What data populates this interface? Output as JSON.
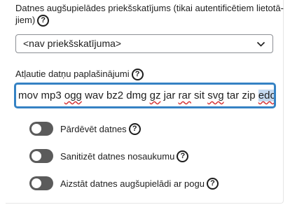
{
  "preview": {
    "label_line1": "Datnes augšupielādes priekšskatījums (tikai autentificētiem lietotā-",
    "label_line2": "jiem)",
    "selected": "<nav priekšskatījuma>"
  },
  "extensions": {
    "label": "Atļautie datņu paplašinājumi",
    "words": [
      "mov",
      "mp3",
      "ogg",
      "wav",
      "bz2",
      "dmg",
      "gz",
      "jar",
      "rar",
      "sit",
      "svg",
      "tar",
      "zip",
      "edoc"
    ]
  },
  "toggles": [
    {
      "label": "Pārdēvēt datnes",
      "on": false
    },
    {
      "label": "Sanitizēt datnes nosaukumu",
      "on": false
    },
    {
      "label": "Aizstāt datnes augšupielādi ar pogu",
      "on": false
    }
  ],
  "help_glyph": "?",
  "icons": {
    "help": "help-circle-icon",
    "dropdown": "chevron-down-icon"
  }
}
